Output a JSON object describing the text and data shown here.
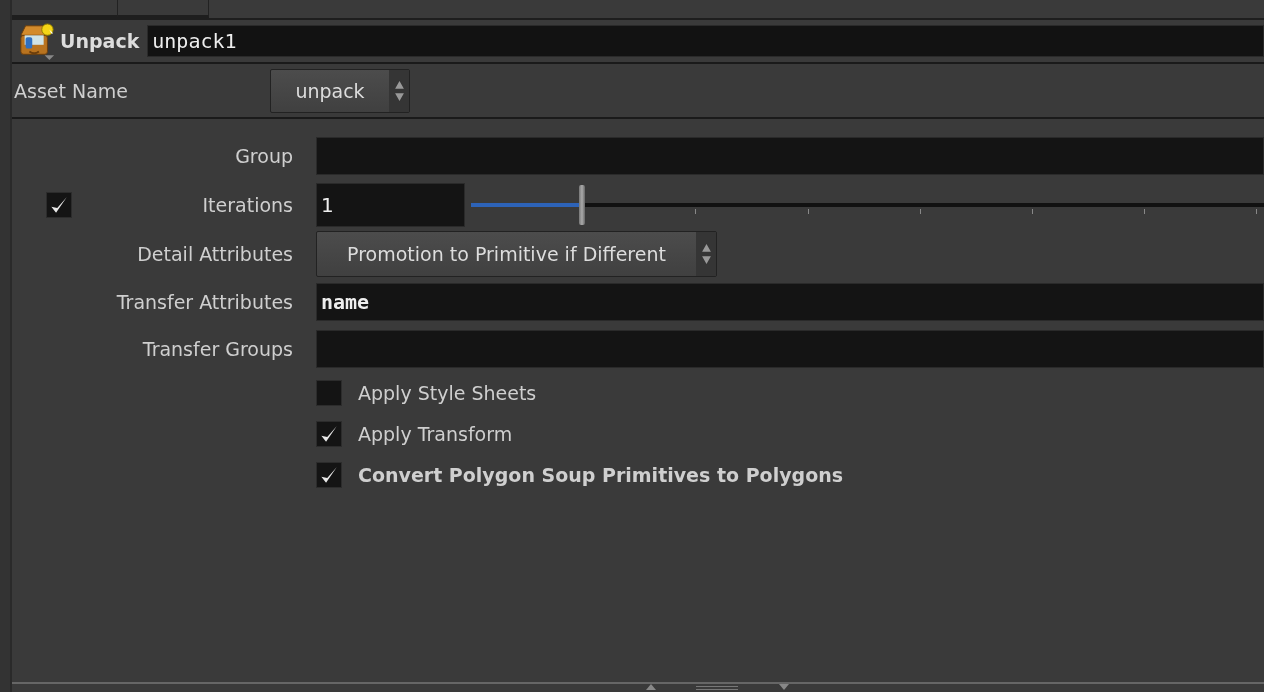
{
  "node": {
    "type_label": "Unpack",
    "name": "unpack1"
  },
  "asset": {
    "label": "Asset Name",
    "value": "unpack"
  },
  "parameters": [
    {
      "kind": "text",
      "label": "Group"
    },
    {
      "kind": "slider",
      "label": "Iterations",
      "value": "1",
      "checked": true,
      "level": 0.14
    },
    {
      "kind": "menu",
      "label": "Detail Attributes",
      "value": "Promotion to Primitive if Different"
    },
    {
      "kind": "text",
      "label": "Transfer Attributes",
      "value": "name"
    },
    {
      "kind": "text",
      "label": "Transfer Groups"
    },
    {
      "kind": "toggle",
      "label": "Apply Style Sheets",
      "checked": false,
      "bold": false
    },
    {
      "kind": "toggle",
      "label": "Apply Transform",
      "checked": true,
      "bold": false
    },
    {
      "kind": "toggle",
      "label": "Convert Polygon Soup Primitives to Polygons",
      "checked": true,
      "bold": true
    }
  ]
}
